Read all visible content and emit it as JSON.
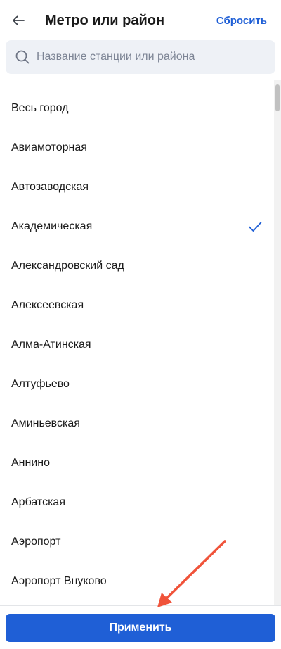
{
  "header": {
    "title": "Метро или район",
    "reset_label": "Сбросить",
    "back_icon": "arrow-left-icon"
  },
  "search": {
    "placeholder": "Название станции или района",
    "value": "",
    "icon": "search-icon"
  },
  "list": {
    "items": [
      {
        "label": "Весь город",
        "selected": false
      },
      {
        "label": "Авиамоторная",
        "selected": false
      },
      {
        "label": "Автозаводская",
        "selected": false
      },
      {
        "label": "Академическая",
        "selected": true
      },
      {
        "label": "Александровский сад",
        "selected": false
      },
      {
        "label": "Алексеевская",
        "selected": false
      },
      {
        "label": "Алма-Атинская",
        "selected": false
      },
      {
        "label": "Алтуфьево",
        "selected": false
      },
      {
        "label": "Аминьевская",
        "selected": false
      },
      {
        "label": "Аннино",
        "selected": false
      },
      {
        "label": "Арбатская",
        "selected": false
      },
      {
        "label": "Аэропорт",
        "selected": false
      },
      {
        "label": "Аэропорт Внуково",
        "selected": false
      }
    ]
  },
  "footer": {
    "apply_label": "Применить"
  },
  "colors": {
    "accent": "#1f5fd6",
    "annotation_arrow": "#f0533a"
  }
}
